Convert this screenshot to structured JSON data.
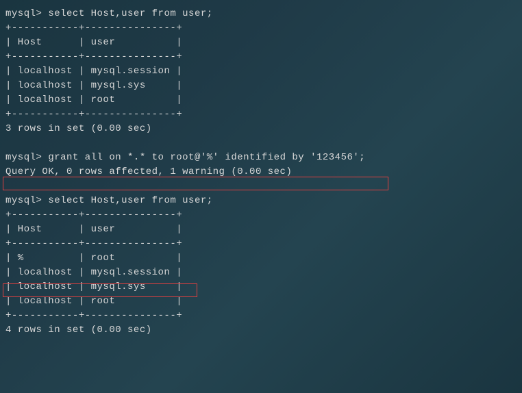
{
  "query1": {
    "prompt": "mysql> ",
    "command": "select Host,user from user;",
    "separator": "+-----------+---------------+",
    "header": "| Host      | user          |",
    "rows": [
      "| localhost | mysql.session |",
      "| localhost | mysql.sys     |",
      "| localhost | root          |"
    ],
    "footer": "3 rows in set (0.00 sec)"
  },
  "grant": {
    "prompt": "mysql> ",
    "command": "grant all on *.* to root@'%' identified by '123456';",
    "result": "Query OK, 0 rows affected, 1 warning (0.00 sec)"
  },
  "query2": {
    "prompt": "mysql> ",
    "command": "select Host,user from user;",
    "separator": "+-----------+---------------+",
    "header": "| Host      | user          |",
    "rows": [
      "| %         | root          |",
      "| localhost | mysql.session |",
      "| localhost | mysql.sys     |",
      "| localhost | root          |"
    ],
    "footer": "4 rows in set (0.00 sec)"
  },
  "chart_data": {
    "type": "table",
    "tables": [
      {
        "title": "user table (before grant)",
        "columns": [
          "Host",
          "user"
        ],
        "rows": [
          [
            "localhost",
            "mysql.session"
          ],
          [
            "localhost",
            "mysql.sys"
          ],
          [
            "localhost",
            "root"
          ]
        ]
      },
      {
        "title": "user table (after grant)",
        "columns": [
          "Host",
          "user"
        ],
        "rows": [
          [
            "%",
            "root"
          ],
          [
            "localhost",
            "mysql.session"
          ],
          [
            "localhost",
            "mysql.sys"
          ],
          [
            "localhost",
            "root"
          ]
        ]
      }
    ]
  }
}
